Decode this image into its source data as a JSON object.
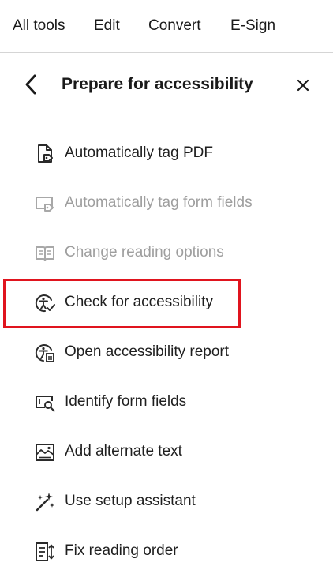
{
  "menubar": {
    "items": [
      "All tools",
      "Edit",
      "Convert",
      "E-Sign"
    ]
  },
  "panel": {
    "title": "Prepare for accessibility",
    "back_icon": "chevron-left-icon",
    "close_icon": "close-icon"
  },
  "tools": [
    {
      "label": "Automatically tag PDF",
      "icon": "tag-document-icon",
      "enabled": true
    },
    {
      "label": "Automatically tag form fields",
      "icon": "tag-form-fields-icon",
      "enabled": false
    },
    {
      "label": "Change reading options",
      "icon": "reading-options-icon",
      "enabled": false
    },
    {
      "label": "Check for accessibility",
      "icon": "accessibility-check-icon",
      "enabled": true,
      "highlighted": true
    },
    {
      "label": "Open accessibility report",
      "icon": "accessibility-report-icon",
      "enabled": true
    },
    {
      "label": "Identify form fields",
      "icon": "identify-form-fields-icon",
      "enabled": true
    },
    {
      "label": "Add alternate text",
      "icon": "alternate-text-icon",
      "enabled": true
    },
    {
      "label": "Use setup assistant",
      "icon": "setup-assistant-icon",
      "enabled": true
    },
    {
      "label": "Fix reading order",
      "icon": "reading-order-icon",
      "enabled": true
    }
  ],
  "colors": {
    "highlight": "#e0141e",
    "text": "#1f1f1f",
    "disabled_text": "#9e9e9e",
    "divider": "#d5d5d5"
  }
}
